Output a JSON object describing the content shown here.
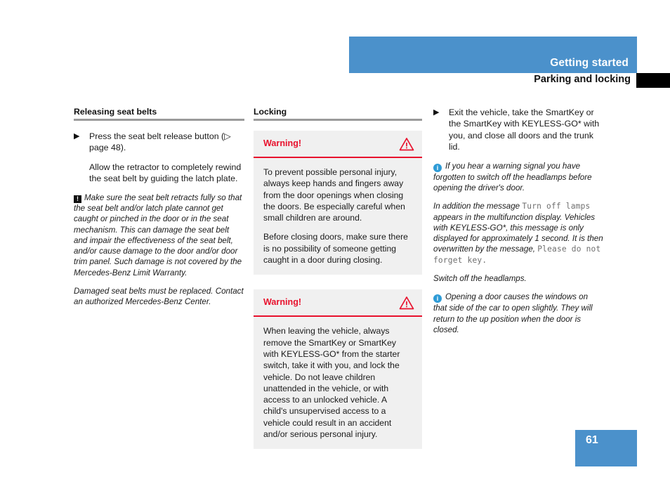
{
  "header": {
    "chapter": "Getting started",
    "section": "Parking and locking"
  },
  "columns": {
    "left": {
      "heading": "Releasing seat belts",
      "step_bullet": "▶",
      "step_text": "Press the seat belt release button (▷ page 48).",
      "step_continuation": "Allow the retractor to completely rewind the seat belt by guiding the latch plate.",
      "caution_icon": "!",
      "caution_text": "Make sure the seat belt retracts fully so that the seat belt and/or latch plate cannot get caught or pinched in the door or in the seat mechanism. This can damage the seat belt and impair the effectiveness of the seat belt, and/or cause damage to the door and/or door trim panel. Such damage is not covered by the Mercedes-Benz Limit Warranty.",
      "note_text": "Damaged seat belts must be replaced. Contact an authorized Mercedes-Benz Center."
    },
    "middle": {
      "heading": "Locking",
      "warnings": [
        {
          "title": "Warning!",
          "icon": "warning-triangle-icon",
          "paragraphs": [
            "To prevent possible personal injury, always keep hands and fingers away from the door openings when closing the doors. Be especially careful when small children are around.",
            "Before closing doors, make sure there is no possibility of someone getting caught in a door during closing."
          ]
        },
        {
          "title": "Warning!",
          "icon": "warning-triangle-icon",
          "paragraphs": [
            "When leaving the vehicle, always remove the SmartKey or SmartKey with KEYLESS-GO* from the starter switch, take it with you, and lock the vehicle. Do not leave children unattended in the vehicle, or with access to an unlocked vehicle. A child's unsupervised access to a vehicle could result in an accident and/or serious personal injury."
          ]
        }
      ]
    },
    "right": {
      "step_bullet": "▶",
      "step_text": "Exit the vehicle, take the SmartKey or the SmartKey with KEYLESS-GO* with you, and close all doors and the trunk lid.",
      "info_icon": "i",
      "info_text_1": "If you hear a warning signal you have forgotten to switch off the headlamps before opening the driver's door.",
      "para_addition_a": "In addition the message",
      "display_msg_1": "Turn off lamps",
      "para_addition_b": "appears in the multifunction display. Vehicles with KEYLESS-GO*, this message is only displayed for approximately 1 second. It is then overwritten by the message,",
      "display_msg_2": "Please do not forget key",
      "para_addition_c": ".",
      "para_switch_off": "Switch off the headlamps.",
      "info_text_2": "Opening a door causes the windows on that side of the car to open slightly. They will return to the up position when the door is closed."
    }
  },
  "page_number": "61",
  "colors": {
    "accent_blue": "#4b91cb",
    "warning_red": "#e8112d",
    "info_blue": "#2e9bd6",
    "box_gray": "#f0f0f0",
    "rule_gray": "#9b9b9b"
  }
}
